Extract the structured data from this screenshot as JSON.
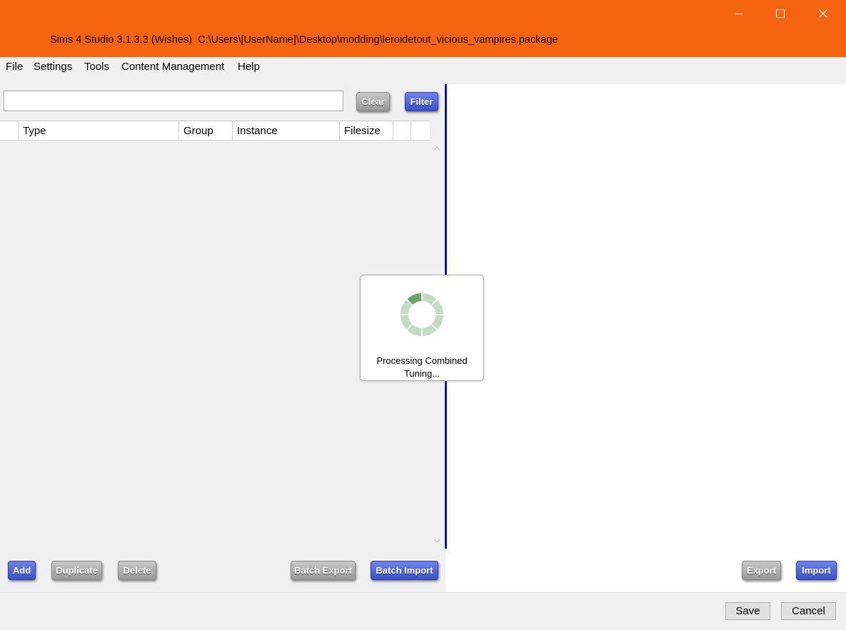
{
  "window": {
    "title": "Sims 4 Studio 3.1.3.3 (Wishes)  C:\\Users\\[UserName]\\Desktop\\modding\\leroidetout_vicious_vampires.package",
    "controls": {
      "minimize": "minimize-icon",
      "maximize": "maximize-icon",
      "close": "close-icon"
    },
    "accent": "#f76411"
  },
  "menu": [
    "File",
    "Settings",
    "Tools",
    "Content Management",
    "Help"
  ],
  "search": {
    "value": "",
    "placeholder": ""
  },
  "filter_bar": {
    "clear_label": "Clear",
    "filter_label": "Filter"
  },
  "grid": {
    "columns": [
      "",
      "Type",
      "Group",
      "Instance",
      "Filesize",
      ""
    ],
    "rows": []
  },
  "toolbar": {
    "add": "Add",
    "duplicate": "Duplicate",
    "delete": "Delete",
    "batch_export": "Batch Export",
    "batch_import": "Batch Import",
    "export": "Export",
    "import": "Import"
  },
  "footer": {
    "save": "Save",
    "cancel": "Cancel"
  },
  "progress": {
    "message": "Processing Combined Tuning..."
  }
}
